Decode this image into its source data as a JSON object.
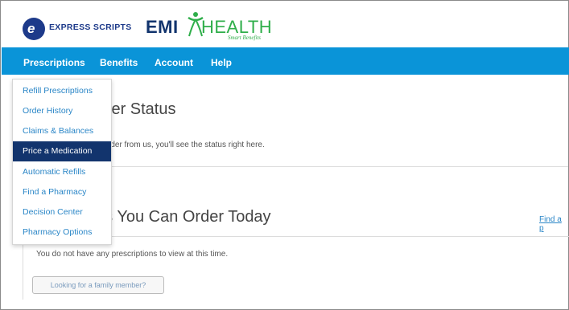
{
  "brand": {
    "express_scripts": "EXPRESS SCRIPTS",
    "emi": "EMI",
    "health": "HEALTH",
    "tagline": "Smart Benefits"
  },
  "nav": {
    "items": [
      {
        "label": "Prescriptions"
      },
      {
        "label": "Benefits"
      },
      {
        "label": "Account"
      },
      {
        "label": "Help"
      }
    ]
  },
  "dropdown": {
    "items": [
      {
        "label": "Refill Prescriptions"
      },
      {
        "label": "Order History"
      },
      {
        "label": "Claims & Balances"
      },
      {
        "label": "Price a Medication",
        "active": true
      },
      {
        "label": "Automatic Refills"
      },
      {
        "label": "Find a Pharmacy"
      },
      {
        "label": "Decision Center"
      },
      {
        "label": "Pharmacy Options"
      }
    ]
  },
  "order_status": {
    "title_visible": "ler Status",
    "message_visible": "rder from us, you'll see the status right here."
  },
  "order_today": {
    "title_visible": "ns You Can Order Today",
    "link_visible": "Find a p",
    "empty_message": "You do not have any prescriptions to view at this time.",
    "family_button": "Looking for a family member?"
  },
  "colors": {
    "nav_bg": "#0a94d8",
    "active_item_bg": "#12346d",
    "link": "#2a86c7",
    "health_green": "#2fae4a"
  }
}
